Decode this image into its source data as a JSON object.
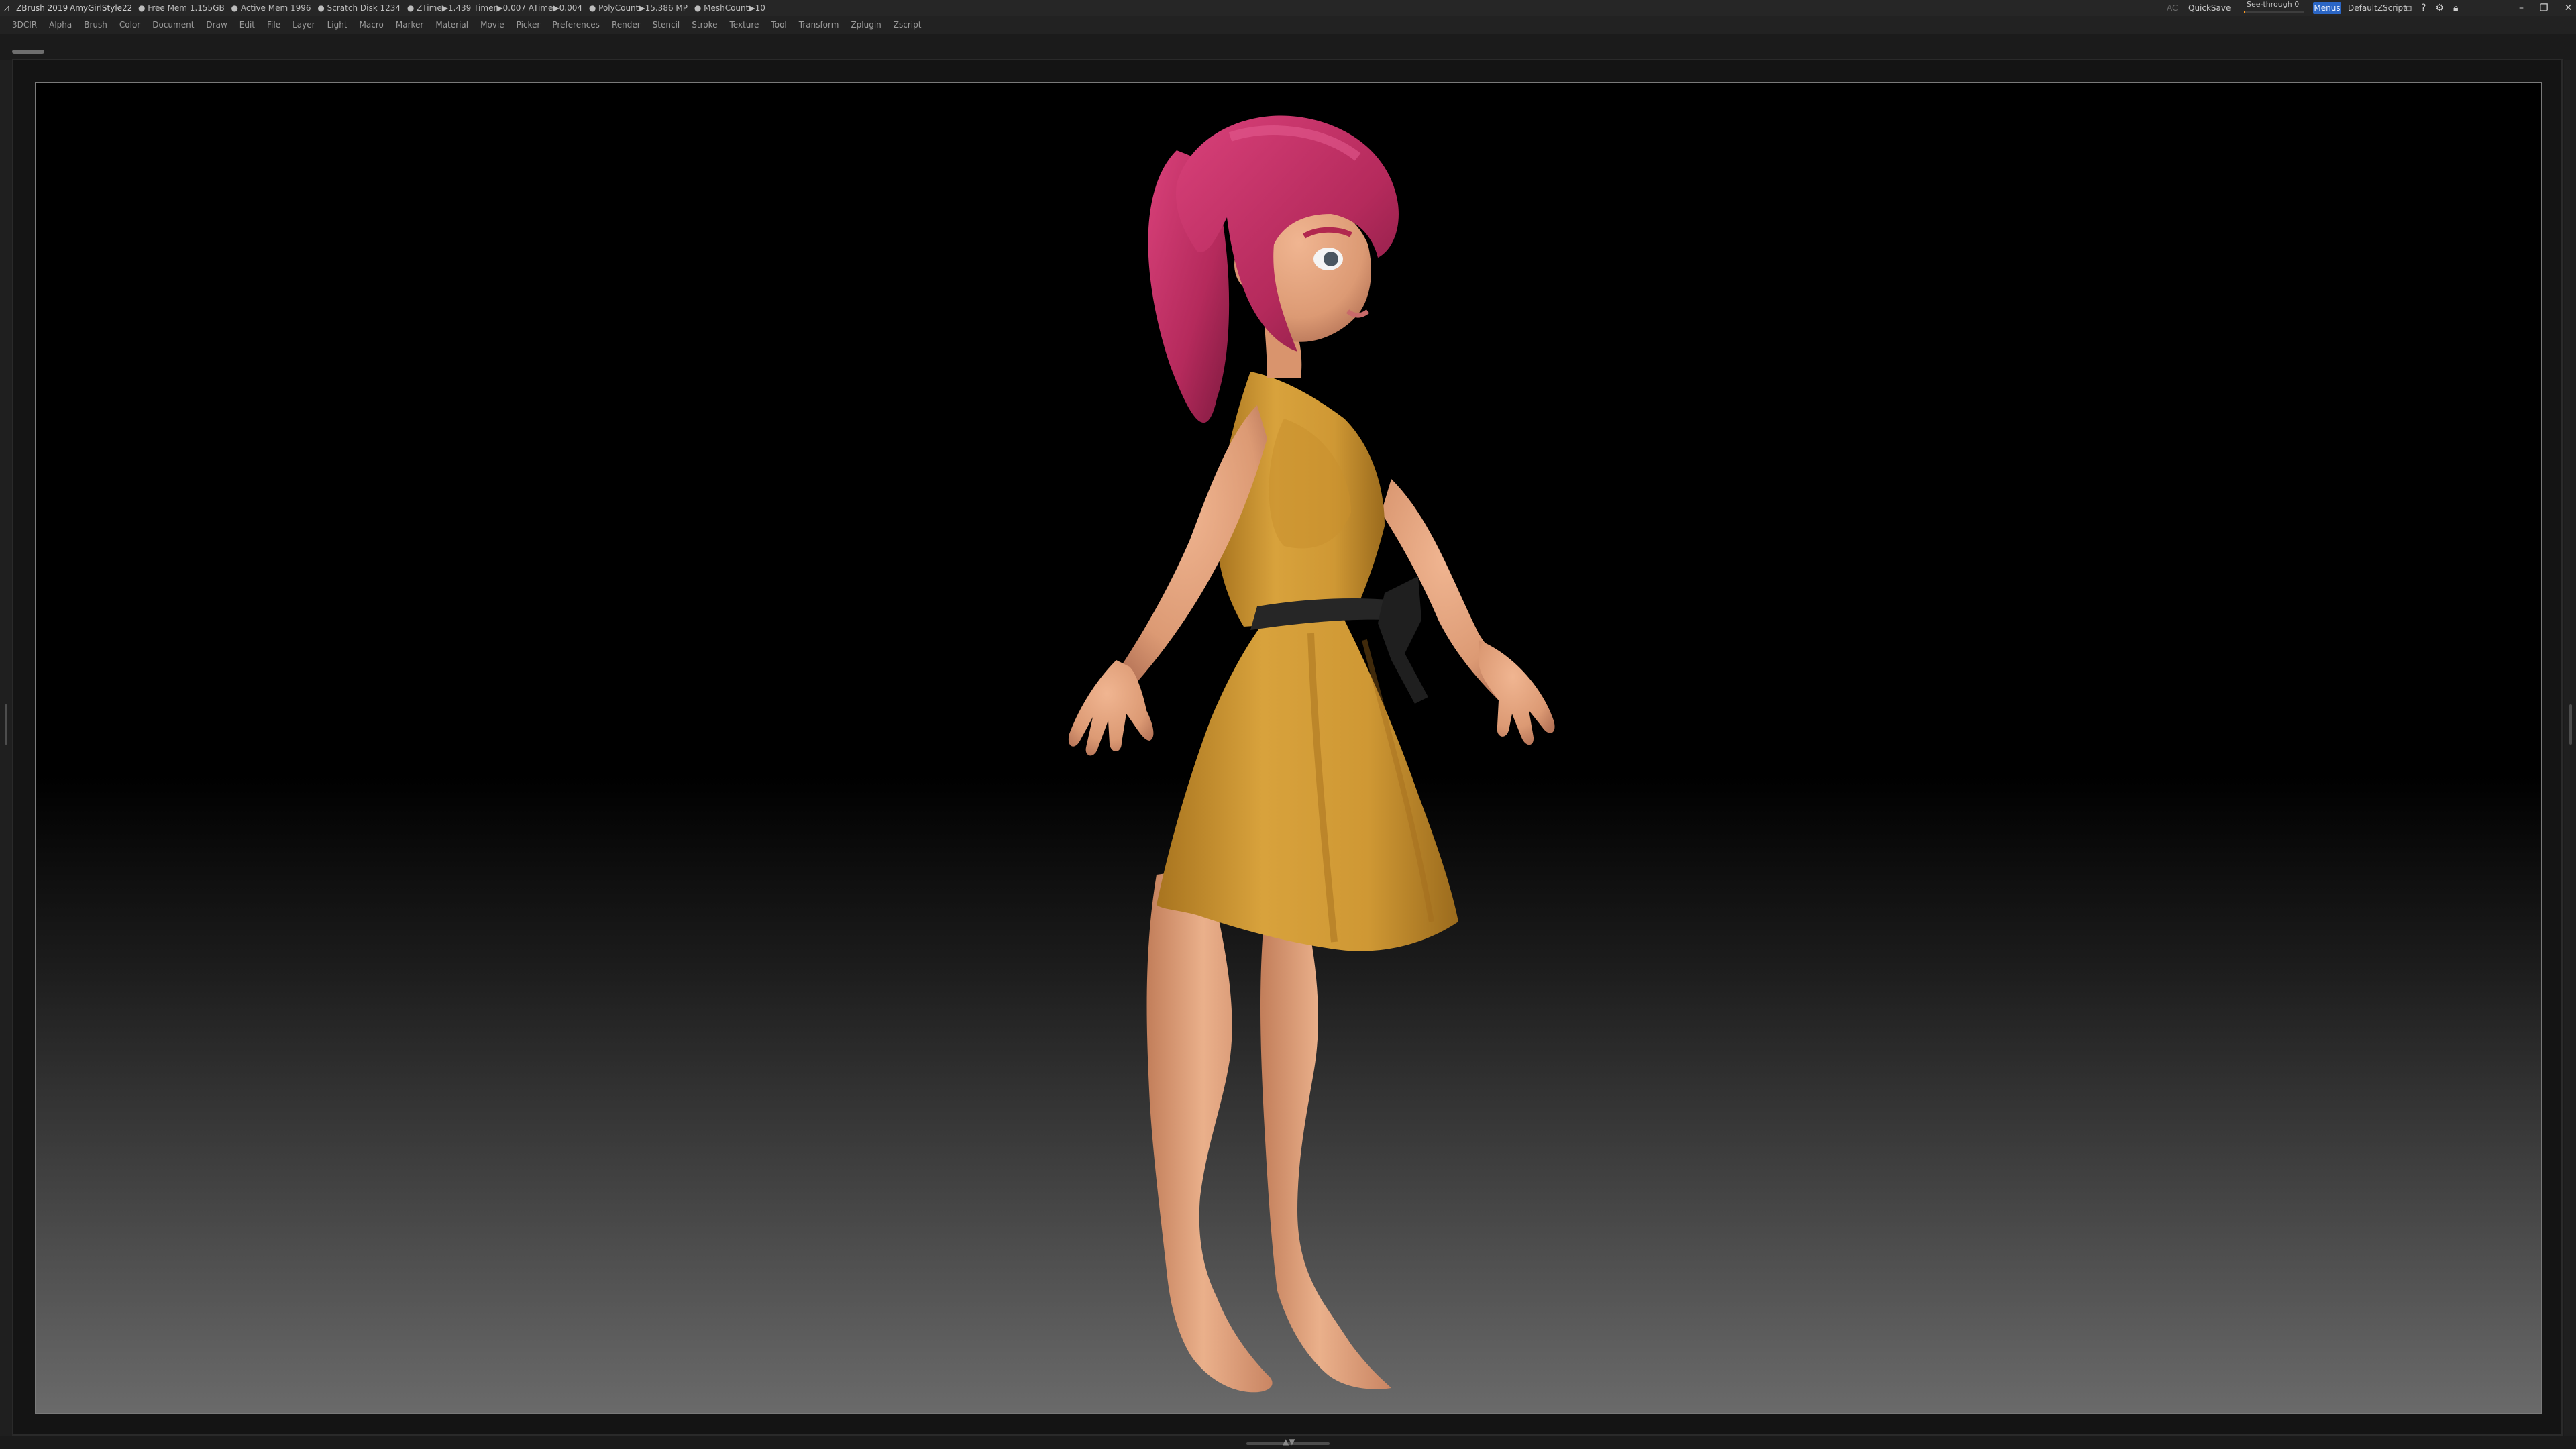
{
  "titlebar": {
    "logo_icon": "zbrush-logo-icon",
    "app_title": "ZBrush 2019",
    "document": "AmyGirlStyle22",
    "stats": [
      "● Free Mem 1.155GB",
      "● Active Mem 1996",
      "● Scratch Disk 1234",
      "● ZTime▶1.439 Timer▶0.007 ATime▶0.004",
      "● PolyCount▶15.386 MP",
      "● MeshCount▶10"
    ],
    "ac": "AC",
    "quicksave": "QuickSave",
    "see_through": {
      "label": "See-through  0",
      "value": 0
    },
    "menus_button": "Menus",
    "default_script": "DefaultZScript",
    "window_icons": [
      "layout-icon",
      "help-icon",
      "settings-icon",
      "lock-icon",
      "minimize-icon",
      "restore-icon",
      "close-icon"
    ]
  },
  "menubar": {
    "items": [
      "3DCIR",
      "Alpha",
      "Brush",
      "Color",
      "Document",
      "Draw",
      "Edit",
      "File",
      "Layer",
      "Light",
      "Macro",
      "Marker",
      "Material",
      "Movie",
      "Picker",
      "Preferences",
      "Render",
      "Stencil",
      "Stroke",
      "Texture",
      "Tool",
      "Transform",
      "Zplugin",
      "Zscript"
    ]
  },
  "viewport": {
    "subject": "3d-character-model",
    "colors": {
      "skin": "#e7a57f",
      "skin_shadow": "#c47c5a",
      "dress": "#d39a33",
      "dress_shadow": "#a7731f",
      "belt": "#262626",
      "hair": "#b52a5c",
      "hair_light": "#d9417a"
    }
  }
}
